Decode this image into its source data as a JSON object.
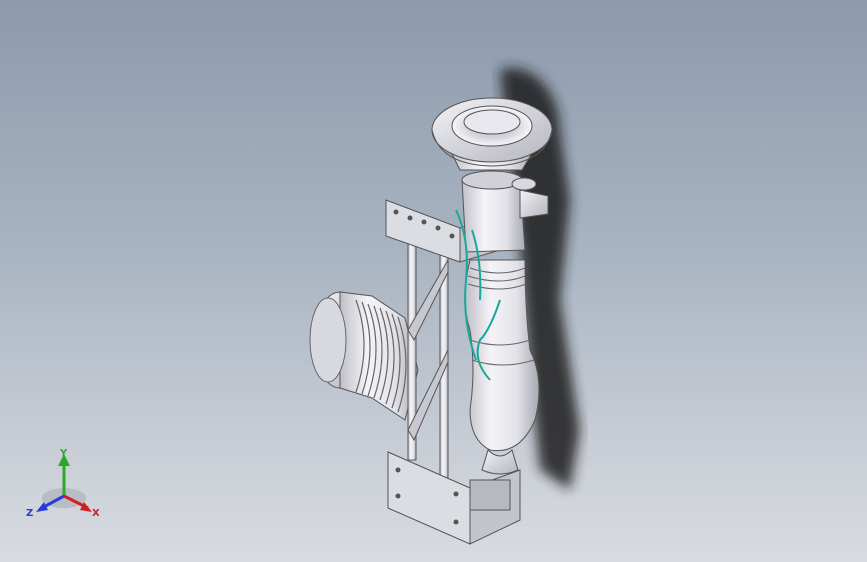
{
  "viewport": {
    "background_top": "#8c9aac",
    "background_bottom": "#d8dbe0"
  },
  "model": {
    "part_color": "#e6e6ec",
    "shadow_color": "#1a1a1a",
    "cable_color": "#1aa89a"
  },
  "triad": {
    "x_label": "X",
    "y_label": "Y",
    "z_label": "Z",
    "x_color": "#d21e1e",
    "y_color": "#2aa82a",
    "z_color": "#2a3ad6"
  }
}
